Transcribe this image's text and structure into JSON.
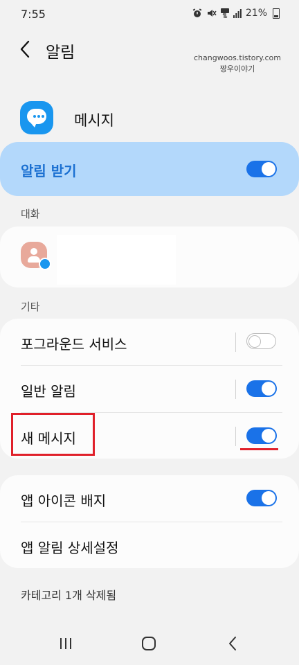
{
  "status_bar": {
    "time": "7:55",
    "battery": "21%",
    "icons": [
      "alarm-icon",
      "mute-icon",
      "data-icon",
      "signal-icon",
      "battery-icon"
    ]
  },
  "header": {
    "title": "알림",
    "watermark_line1": "changwoos.tistory.com",
    "watermark_line2": "짱우이야기"
  },
  "app": {
    "name": "메시지",
    "icon": "messages-icon"
  },
  "master_toggle": {
    "label": "알림 받기",
    "state": true
  },
  "sections": {
    "conversations_label": "대화",
    "other_label": "기타"
  },
  "other_items": [
    {
      "label": "포그라운드 서비스",
      "state": false
    },
    {
      "label": "일반 알림",
      "state": true
    },
    {
      "label": "새 메시지",
      "state": true
    }
  ],
  "badge_items": {
    "app_icon_badge_label": "앱 아이콘 배지",
    "app_icon_badge_state": true,
    "detail_settings_label": "앱 알림 상세설정"
  },
  "footer": {
    "deleted_note": "카테고리 1개 삭제됨"
  },
  "colors": {
    "accent": "#1a72e8",
    "master_bg": "#b3d8fb",
    "highlight": "#e0202a"
  }
}
